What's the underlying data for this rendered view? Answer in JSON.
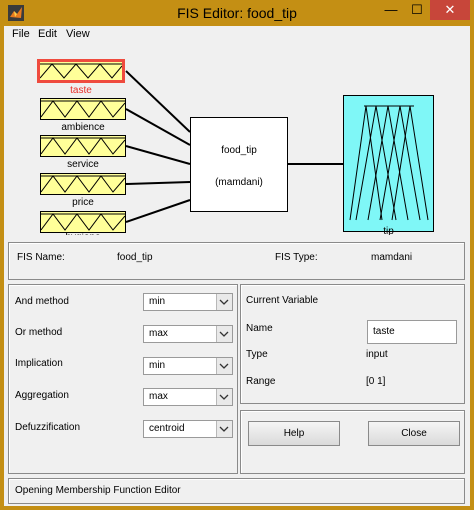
{
  "window": {
    "title": "FIS Editor: food_tip",
    "min_glyph": "—",
    "max_glyph": "☐",
    "close_glyph": "✕"
  },
  "menubar": {
    "items": [
      "File",
      "Edit",
      "View"
    ]
  },
  "inputs": [
    {
      "label": "taste",
      "selected": true
    },
    {
      "label": "ambience",
      "selected": false
    },
    {
      "label": "service",
      "selected": false
    },
    {
      "label": "price",
      "selected": false
    },
    {
      "label": "hygiene",
      "selected": false
    }
  ],
  "system": {
    "name": "food_tip",
    "type_label": "(mamdani)"
  },
  "output": {
    "label": "tip"
  },
  "info": {
    "name_label": "FIS Name:",
    "name_value": "food_tip",
    "type_label": "FIS Type:",
    "type_value": "mamdani"
  },
  "methods": {
    "and_label": "And method",
    "and_value": "min",
    "or_label": "Or method",
    "or_value": "max",
    "impl_label": "Implication",
    "impl_value": "min",
    "agg_label": "Aggregation",
    "agg_value": "max",
    "defuzz_label": "Defuzzification",
    "defuzz_value": "centroid"
  },
  "current_variable": {
    "heading": "Current Variable",
    "name_label": "Name",
    "name_value": "taste",
    "type_label": "Type",
    "type_value": "input",
    "range_label": "Range",
    "range_value": "[0 1]"
  },
  "buttons": {
    "help": "Help",
    "close": "Close"
  },
  "status": {
    "text": "Opening Membership Function Editor"
  },
  "colors": {
    "input_fill": "#ffff99",
    "output_fill": "#7ff7f7",
    "selected": "#ef4b3e",
    "titlebar": "#c48f14"
  }
}
